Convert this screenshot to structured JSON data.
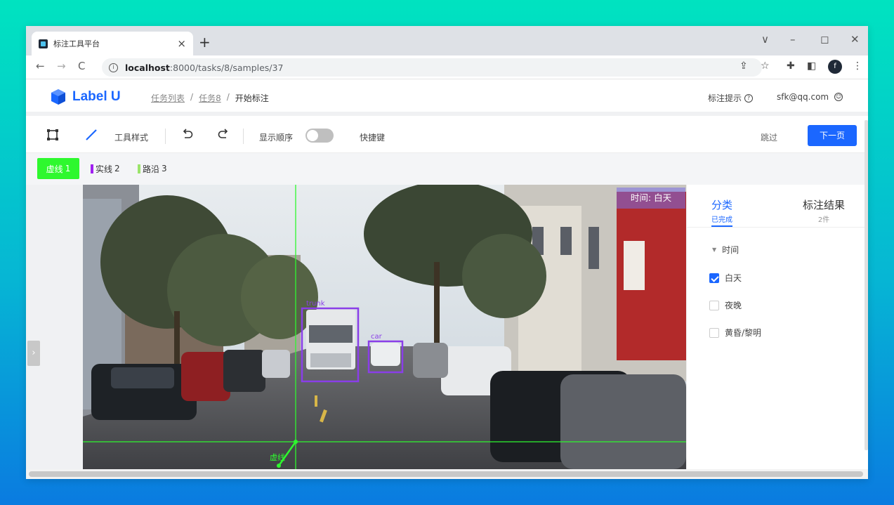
{
  "browser": {
    "tab_title": "标注工具平台",
    "tab_close": "×",
    "new_tab": "+",
    "url_host": "localhost",
    "url_path": ":8000/tasks/8/samples/37",
    "window_controls": [
      "∨",
      "–",
      "◻",
      "✕"
    ]
  },
  "app": {
    "logo_text": "Label U",
    "breadcrumb": {
      "items": [
        "任务列表",
        "任务8",
        "开始标注"
      ],
      "separator": "/"
    },
    "header_right": {
      "hint_label": "标注提示",
      "user_email": "sfk@qq.com"
    }
  },
  "toolbar": {
    "tool_style_label": "工具样式",
    "show_order_label": "显示顺序",
    "shortcuts_label": "快捷键",
    "skip_label": "跳过",
    "next_label": "下一页",
    "show_order_on": false
  },
  "labels": [
    {
      "name": "虚线",
      "count": "1",
      "color": "#2ef82e",
      "active": true
    },
    {
      "name": "实线",
      "count": "2",
      "color": "#a020f0",
      "active": false
    },
    {
      "name": "路沿",
      "count": "3",
      "color": "#9be46a",
      "active": false
    }
  ],
  "canvas": {
    "time_badge": "时间: 白天",
    "box_labels": [
      "trunk",
      "car"
    ],
    "line_label": "虚线"
  },
  "right_panel": {
    "tabs": [
      {
        "title": "分类",
        "sub": "已完成"
      },
      {
        "title": "标注结果",
        "sub": "2件"
      }
    ],
    "group_title": "时间",
    "options": [
      {
        "label": "白天",
        "checked": true
      },
      {
        "label": "夜晚",
        "checked": false
      },
      {
        "label": "黄昏/黎明",
        "checked": false
      }
    ]
  },
  "colors": {
    "accent": "#1b67ff",
    "active_label": "#2ef82e",
    "bbox": "#8a3ee8"
  }
}
